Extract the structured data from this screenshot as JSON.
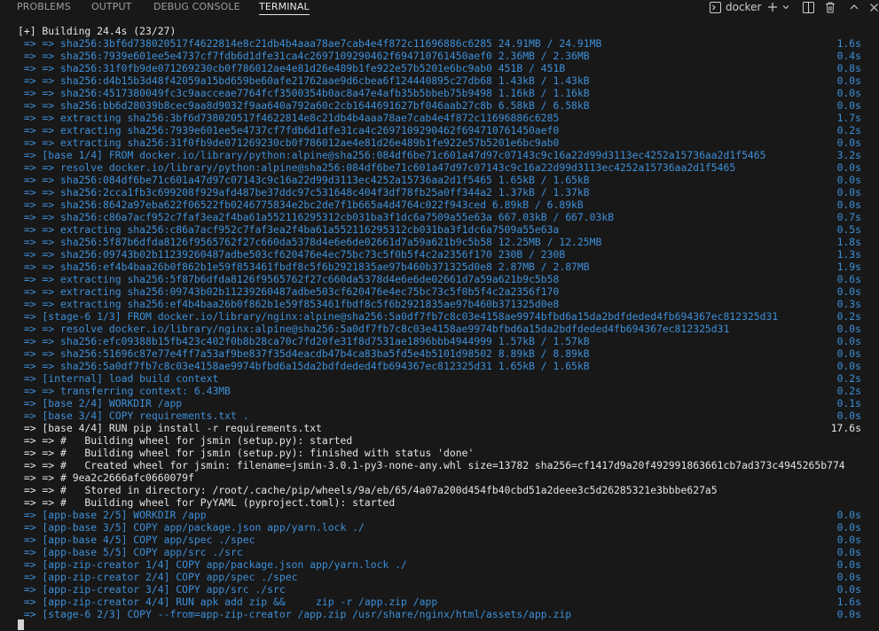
{
  "panel": {
    "tabs": [
      {
        "label": "PROBLEMS"
      },
      {
        "label": "OUTPUT"
      },
      {
        "label": "DEBUG CONSOLE"
      },
      {
        "label": "TERMINAL"
      }
    ],
    "terminal_name": "docker",
    "icons": [
      "terminal-icon",
      "plus-icon",
      "chevron-down-icon",
      "split-terminal-icon",
      "trash-icon",
      "chevron-up-icon",
      "close-icon"
    ]
  },
  "terminal": {
    "lines": [
      {
        "text": "[+] Building 24.4s (23/27)",
        "time": "",
        "style": "white"
      },
      {
        "text": " => => sha256:3bf6d738020517f4622814e8c21db4b4aaa78ae7cab4e4f872c11696886c6285 24.91MB / 24.91MB",
        "time": "1.6s",
        "style": "blue"
      },
      {
        "text": " => => sha256:7939e601ee5e4737cf7fdb6d1dfe31ca4c2697109290462f694710761450aef0 2.36MB / 2.36MB",
        "time": "0.4s",
        "style": "blue"
      },
      {
        "text": " => => sha256:31f0fb9de071269230cb0f786012ae4e81d26e489b1fe922e57b5201e6bc9ab0 451B / 451B",
        "time": "0.8s",
        "style": "blue"
      },
      {
        "text": " => => sha256:d4b15b3d48f42059a15bd659be60afe21762aae9d6cbea6f124440895c27db68 1.43kB / 1.43kB",
        "time": "0.0s",
        "style": "blue"
      },
      {
        "text": " => => sha256:4517380049fc3c9aacceae7764fcf3500354b0ac8a47e4afb35b5bbeb75b9498 1.16kB / 1.16kB",
        "time": "0.0s",
        "style": "blue"
      },
      {
        "text": " => => sha256:bb6d28039b8cec9aa8d9032f9aa640a792a60c2cb1644691627bf046aab27c8b 6.58kB / 6.58kB",
        "time": "0.0s",
        "style": "blue"
      },
      {
        "text": " => => extracting sha256:3bf6d738020517f4622814e8c21db4b4aaa78ae7cab4e4f872c11696886c6285",
        "time": "1.7s",
        "style": "blue"
      },
      {
        "text": " => => extracting sha256:7939e601ee5e4737cf7fdb6d1dfe31ca4c2697109290462f694710761450aef0",
        "time": "0.2s",
        "style": "blue"
      },
      {
        "text": " => => extracting sha256:31f0fb9de071269230cb0f786012ae4e81d26e489b1fe922e57b5201e6bc9ab0",
        "time": "0.0s",
        "style": "blue"
      },
      {
        "text": " => [base 1/4] FROM docker.io/library/python:alpine@sha256:084df6be71c601a47d97c07143c9c16a22d99d3113ec4252a15736aa2d1f5465",
        "time": "3.2s",
        "style": "blue"
      },
      {
        "text": " => => resolve docker.io/library/python:alpine@sha256:084df6be71c601a47d97c07143c9c16a22d99d3113ec4252a15736aa2d1f5465",
        "time": "0.0s",
        "style": "blue"
      },
      {
        "text": " => => sha256:084df6be71c601a47d97c07143c9c16a22d99d3113ec4252a15736aa2d1f5465 1.65kB / 1.65kB",
        "time": "0.0s",
        "style": "blue"
      },
      {
        "text": " => => sha256:2cca1fb3c699208f929afd487be37ddc97c531648c404f3df78fb25a0ff344a2 1.37kB / 1.37kB",
        "time": "0.0s",
        "style": "blue"
      },
      {
        "text": " => => sha256:8642a97eba622f06522fb0246775834e2bc2de7f1b665a4d4764c022f943ced 6.89kB / 6.89kB",
        "time": "0.0s",
        "style": "blue"
      },
      {
        "text": " => => sha256:c86a7acf952c7faf3ea2f4ba61a552116295312cb031ba3f1dc6a7509a55e63a 667.03kB / 667.03kB",
        "time": "0.7s",
        "style": "blue"
      },
      {
        "text": " => => extracting sha256:c86a7acf952c7faf3ea2f4ba61a552116295312cb031ba3f1dc6a7509a55e63a",
        "time": "0.5s",
        "style": "blue"
      },
      {
        "text": " => => sha256:5f87b6dfda8126f9565762f27c660da5378d4e6e6de02661d7a59a621b9c5b58 12.25MB / 12.25MB",
        "time": "1.8s",
        "style": "blue"
      },
      {
        "text": " => => sha256:09743b02b11239260487adbe503cf620476e4ec75bc73c5f0b5f4c2a2356f170 230B / 230B",
        "time": "1.3s",
        "style": "blue"
      },
      {
        "text": " => => sha256:ef4b4baa26b0f862b1e59f853461fbdf8c5f6b2921835ae97b460b371325d0e8 2.87MB / 2.87MB",
        "time": "1.9s",
        "style": "blue"
      },
      {
        "text": " => => extracting sha256:5f87b6dfda8126f9565762f27c660da5378d4e6e6de02661d7a59a621b9c5b58",
        "time": "0.6s",
        "style": "blue"
      },
      {
        "text": " => => extracting sha256:09743b02b11239260487adbe503cf620476e4ec75bc73c5f0b5f4c2a2356f170",
        "time": "0.0s",
        "style": "blue"
      },
      {
        "text": " => => extracting sha256:ef4b4baa26b0f862b1e59f853461fbdf8c5f6b2921835ae97b460b371325d0e8",
        "time": "0.3s",
        "style": "blue"
      },
      {
        "text": " => [stage-6 1/3] FROM docker.io/library/nginx:alpine@sha256:5a0df7fb7c8c03e4158ae9974bfbd6a15da2bdfdeded4fb694367ec812325d31",
        "time": "0.2s",
        "style": "blue"
      },
      {
        "text": " => => resolve docker.io/library/nginx:alpine@sha256:5a0df7fb7c8c03e4158ae9974bfbd6a15da2bdfdeded4fb694367ec812325d31",
        "time": "0.0s",
        "style": "blue"
      },
      {
        "text": " => => sha256:efc09388b15fb423c402f0b8b28ca70c7fd20fe31f8d7531ae1896bbb4944999 1.57kB / 1.57kB",
        "time": "0.0s",
        "style": "blue"
      },
      {
        "text": " => => sha256:51696c87e77e4ff7a53af9be837f35d4eacdb47b4ca83ba5fd5e4b5101d98502 8.89kB / 8.89kB",
        "time": "0.0s",
        "style": "blue"
      },
      {
        "text": " => => sha256:5a0df7fb7c8c03e4158ae9974bfbd6a15da2bdfdeded4fb694367ec812325d31 1.65kB / 1.65kB",
        "time": "0.0s",
        "style": "blue"
      },
      {
        "text": " => [internal] load build context",
        "time": "0.2s",
        "style": "blue"
      },
      {
        "text": " => => transferring context: 6.43MB",
        "time": "0.2s",
        "style": "blue"
      },
      {
        "text": " => [base 2/4] WORKDIR /app",
        "time": "0.1s",
        "style": "blue"
      },
      {
        "text": " => [base 3/4] COPY requirements.txt .",
        "time": "0.0s",
        "style": "blue"
      },
      {
        "text": " => [base 4/4] RUN pip install -r requirements.txt",
        "time": "17.6s",
        "style": "white"
      },
      {
        "text": " => => #   Building wheel for jsmin (setup.py): started",
        "time": "",
        "style": "white"
      },
      {
        "text": " => => #   Building wheel for jsmin (setup.py): finished with status 'done'",
        "time": "",
        "style": "white"
      },
      {
        "text": " => => #   Created wheel for jsmin: filename=jsmin-3.0.1-py3-none-any.whl size=13782 sha256=cf1417d9a20f492991863661cb7ad373c4945265b774",
        "time": "",
        "style": "white"
      },
      {
        "text": " => => # 9ea2c2666afc0660079f",
        "time": "",
        "style": "white"
      },
      {
        "text": " => => #   Stored in directory: /root/.cache/pip/wheels/9a/eb/65/4a07a200d454fb40cbd51a2deee3c5d26285321e3bbbe627a5",
        "time": "",
        "style": "white"
      },
      {
        "text": " => => #   Building wheel for PyYAML (pyproject.toml): started",
        "time": "",
        "style": "white"
      },
      {
        "text": " => [app-base 2/5] WORKDIR /app",
        "time": "0.0s",
        "style": "blue"
      },
      {
        "text": " => [app-base 3/5] COPY app/package.json app/yarn.lock ./",
        "time": "0.0s",
        "style": "blue"
      },
      {
        "text": " => [app-base 4/5] COPY app/spec ./spec",
        "time": "0.0s",
        "style": "blue"
      },
      {
        "text": " => [app-base 5/5] COPY app/src ./src",
        "time": "0.0s",
        "style": "blue"
      },
      {
        "text": " => [app-zip-creator 1/4] COPY app/package.json app/yarn.lock ./",
        "time": "0.0s",
        "style": "blue"
      },
      {
        "text": " => [app-zip-creator 2/4] COPY app/spec ./spec",
        "time": "0.0s",
        "style": "blue"
      },
      {
        "text": " => [app-zip-creator 3/4] COPY app/src ./src",
        "time": "0.0s",
        "style": "blue"
      },
      {
        "text": " => [app-zip-creator 4/4] RUN apk add zip &&     zip -r /app.zip /app",
        "time": "1.6s",
        "style": "blue"
      },
      {
        "text": " => [stage-6 2/3] COPY --from=app-zip-creator /app.zip /usr/share/nginx/html/assets/app.zip",
        "time": "0.0s",
        "style": "blue"
      }
    ]
  }
}
